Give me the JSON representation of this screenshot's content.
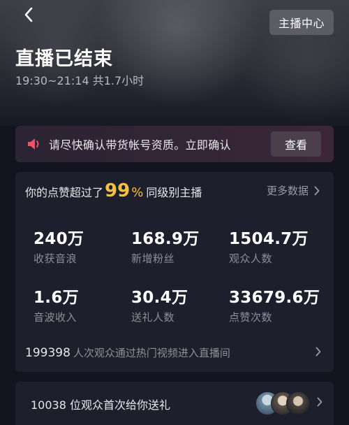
{
  "header": {
    "center_button": "主播中心",
    "title": "直播已结束",
    "subtitle": "19:30~21:14 共1.7小时"
  },
  "banner": {
    "text": "请尽快确认带货帐号资质。立即确认",
    "button": "查看"
  },
  "summary": {
    "likes_prefix": "你的点赞超过了",
    "likes_pct": "99",
    "likes_pct_sign": "%",
    "likes_suffix": "同级别主播",
    "more_label": "更多数据",
    "stats": [
      {
        "value": "240万",
        "label": "收获音浪"
      },
      {
        "value": "168.9万",
        "label": "新增粉丝"
      },
      {
        "value": "1504.7万",
        "label": "观众人数"
      },
      {
        "value": "1.6万",
        "label": "音波收入"
      },
      {
        "value": "30.4万",
        "label": "送礼人数"
      },
      {
        "value": "33679.6万",
        "label": "点赞次数"
      }
    ],
    "hot_count": "199398",
    "hot_text": "人次观众通过热门视频进入直播间"
  },
  "gift": {
    "text": "10038 位观众首次给你送礼"
  },
  "colors": {
    "accent": "#f6c23e",
    "card": "#1d1f2c",
    "banner": "#3a2638"
  },
  "icons": {
    "back": "chevron-left-icon",
    "speaker": "speaker-icon",
    "chevron": "chevron-right-icon"
  }
}
